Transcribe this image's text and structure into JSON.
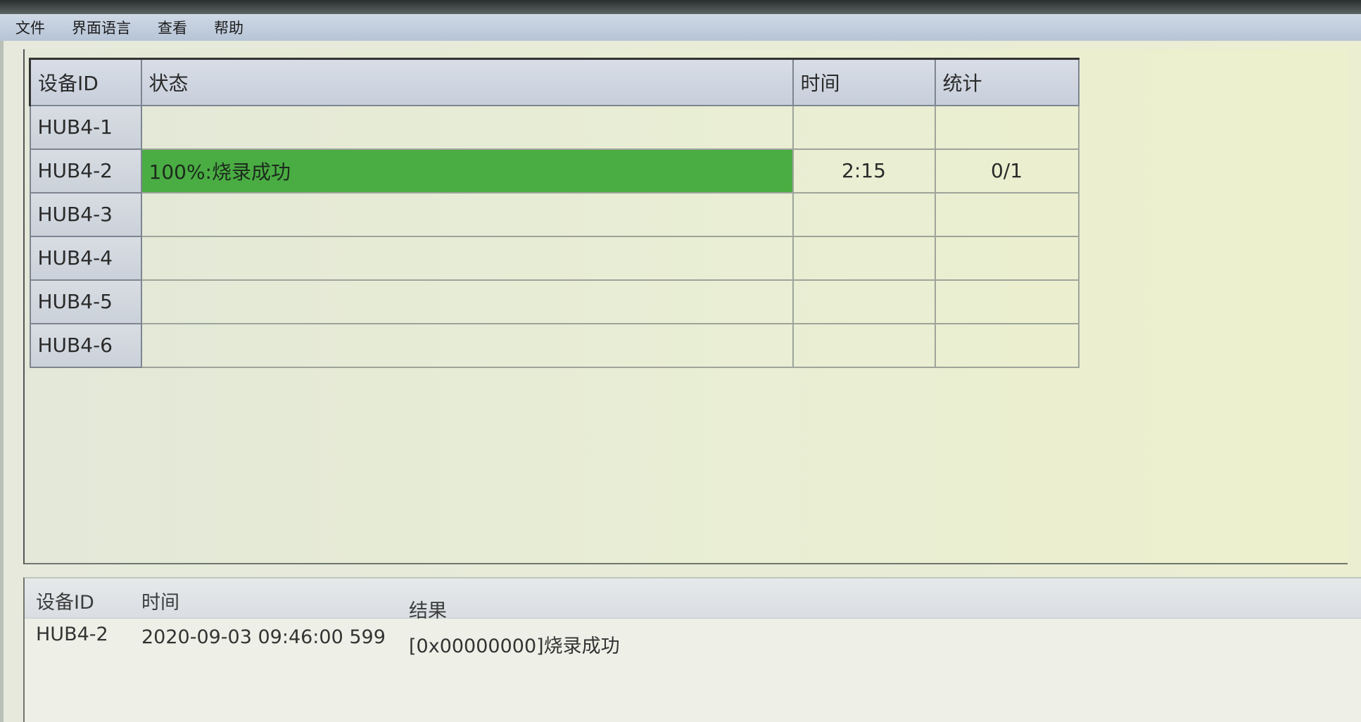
{
  "menu": [
    "文件",
    "界面语言",
    "查看",
    "帮助"
  ],
  "grid": {
    "columns": [
      "设备ID",
      "状态",
      "时间",
      "统计"
    ],
    "rows": [
      {
        "id": "HUB4-1",
        "status": "",
        "time": "",
        "stat": ""
      },
      {
        "id": "HUB4-2",
        "status": "100%:烧录成功",
        "time": "2:15",
        "stat": "0/1"
      },
      {
        "id": "HUB4-3",
        "status": "",
        "time": "",
        "stat": ""
      },
      {
        "id": "HUB4-4",
        "status": "",
        "time": "",
        "stat": ""
      },
      {
        "id": "HUB4-5",
        "status": "",
        "time": "",
        "stat": ""
      },
      {
        "id": "HUB4-6",
        "status": "",
        "time": "",
        "stat": ""
      }
    ],
    "success_color": "#4aad43"
  },
  "log": {
    "columns": [
      "设备ID",
      "时间",
      "结果"
    ],
    "rows": [
      {
        "id": "HUB4-2",
        "time": "2020-09-03 09:46:00 599",
        "result": "[0x00000000]烧录成功"
      }
    ]
  }
}
